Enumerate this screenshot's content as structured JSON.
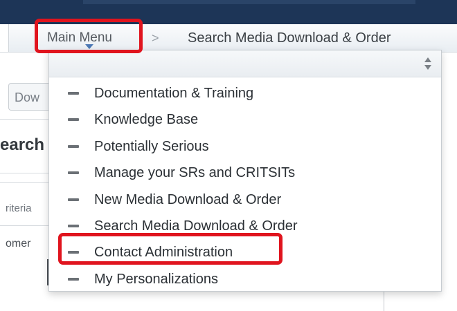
{
  "navbar": {
    "main_menu_label": "Main Menu",
    "breadcrumb_separator": ">",
    "current_page": "Search Media Download & Order"
  },
  "background_page": {
    "tab_label": "Dow",
    "heading": "earch",
    "criteria_label": "riteria",
    "customer_label": "omer"
  },
  "dropdown": {
    "items": [
      {
        "label": "Documentation & Training"
      },
      {
        "label": "Knowledge Base"
      },
      {
        "label": "Potentially Serious"
      },
      {
        "label": "Manage your SRs and CRITSITs"
      },
      {
        "label": "New Media Download & Order"
      },
      {
        "label": "Search Media Download & Order"
      },
      {
        "label": "Contact Administration"
      },
      {
        "label": "My Personalizations"
      }
    ]
  },
  "annotations": {
    "highlight_color": "#e0141e",
    "highlighted": [
      "Main Menu",
      "Contact Administration"
    ]
  }
}
